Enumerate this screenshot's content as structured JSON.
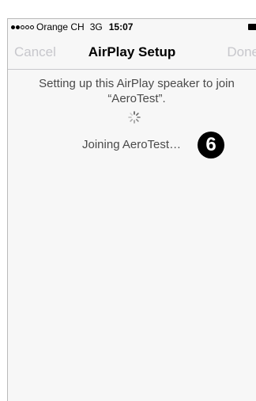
{
  "status_bar": {
    "carrier": "Orange CH",
    "network": "3G",
    "time": "15:07",
    "signal_bars_filled": 2,
    "signal_bars_total": 5,
    "battery_icon": "battery-icon"
  },
  "nav": {
    "cancel_label": "Cancel",
    "title": "AirPlay Setup",
    "done_label": "Done"
  },
  "content": {
    "message": "Setting up this AirPlay speaker to join “AeroTest”.",
    "spinner_icon": "activity-spinner-icon",
    "joining_text": "Joining AeroTest…",
    "step_number": "6"
  },
  "colors": {
    "disabled_nav": "#c7c7cc",
    "body_text": "#4a4a4a",
    "badge_bg": "#000000"
  }
}
